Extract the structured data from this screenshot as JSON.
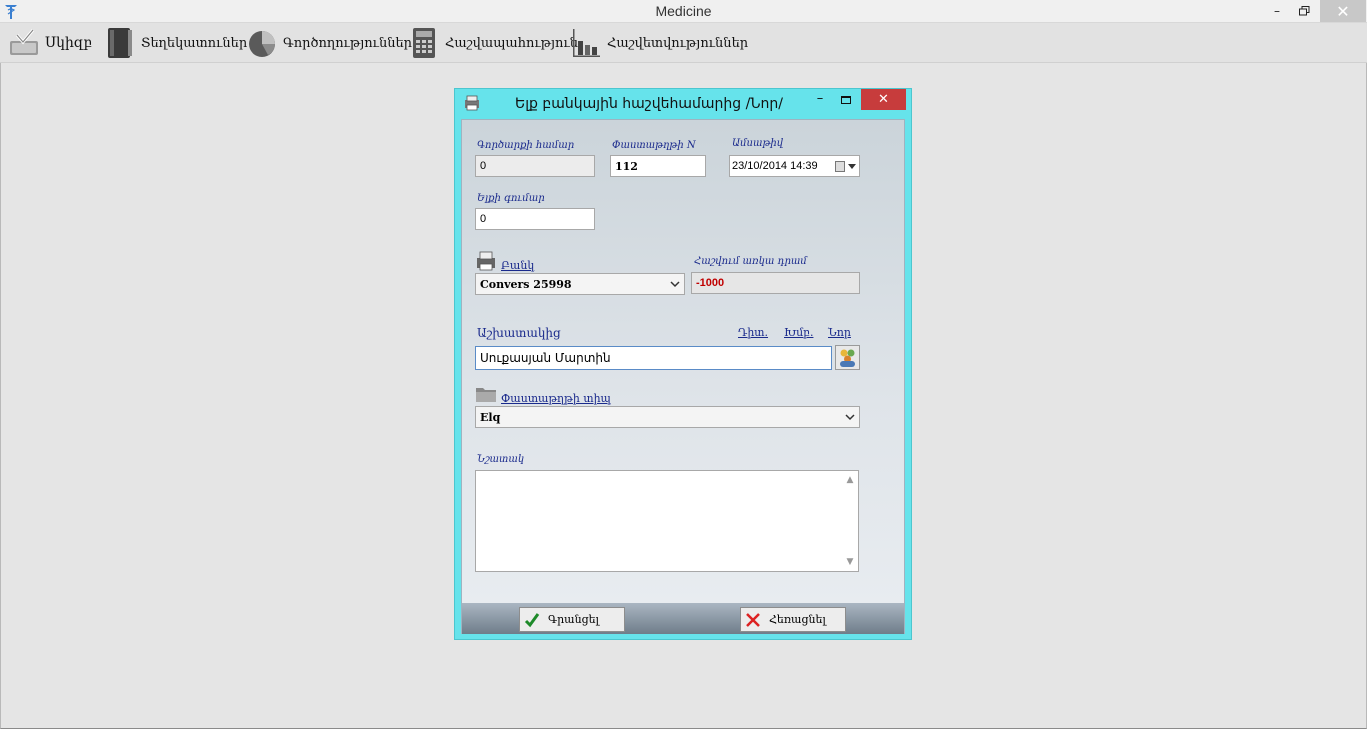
{
  "window": {
    "title": "Medicine",
    "minimize": "–",
    "close": "✕"
  },
  "toolbar": {
    "items": [
      {
        "label": "Սկիզբ",
        "icon": "checkmark-tray-icon"
      },
      {
        "label": "Տեղեկատուներ",
        "icon": "book-icon"
      },
      {
        "label": "Գործողություններ",
        "icon": "pie-chart-icon"
      },
      {
        "label": "Հաշվապահություն",
        "icon": "calculator-icon"
      },
      {
        "label": "Հաշվետվություններ",
        "icon": "bar-chart-icon"
      }
    ]
  },
  "dialog": {
    "title": "Ելք բանկային հաշվեհամարից /Նոր/",
    "minimize": "–",
    "close": "✕",
    "fields": {
      "op_number_label": "Գործարքի համար",
      "op_number_value": "0",
      "doc_number_label": "Փաստաթղթի N",
      "doc_number_value": "112",
      "date_label": "Ամսաթիվ",
      "date_value": "23/10/2014 14:39",
      "amount_label": "Ելքի գումար",
      "amount_value": "0",
      "bank_label": "Բանկ",
      "bank_value": "Convers 25998",
      "balance_label": "Հաշվում առկա դրամ",
      "balance_value": "-1000",
      "employee_label": "Աշխատակից",
      "employee_links": [
        "Դիտ.",
        "Խմբ.",
        "Նոր"
      ],
      "employee_value": "Սուքասյան Մարտին",
      "doc_type_label": "Փաստաթղթի տիպ",
      "doc_type_value": "Elq",
      "note_label": "Նշատակ"
    },
    "buttons": {
      "save": "Գրանցել",
      "cancel": "Հեռացնել"
    }
  },
  "colors": {
    "dialog_frame": "#66e3eb",
    "label_blue": "#1a2a8c",
    "negative_red": "#c00000",
    "dialog_close": "#c73c3c"
  }
}
